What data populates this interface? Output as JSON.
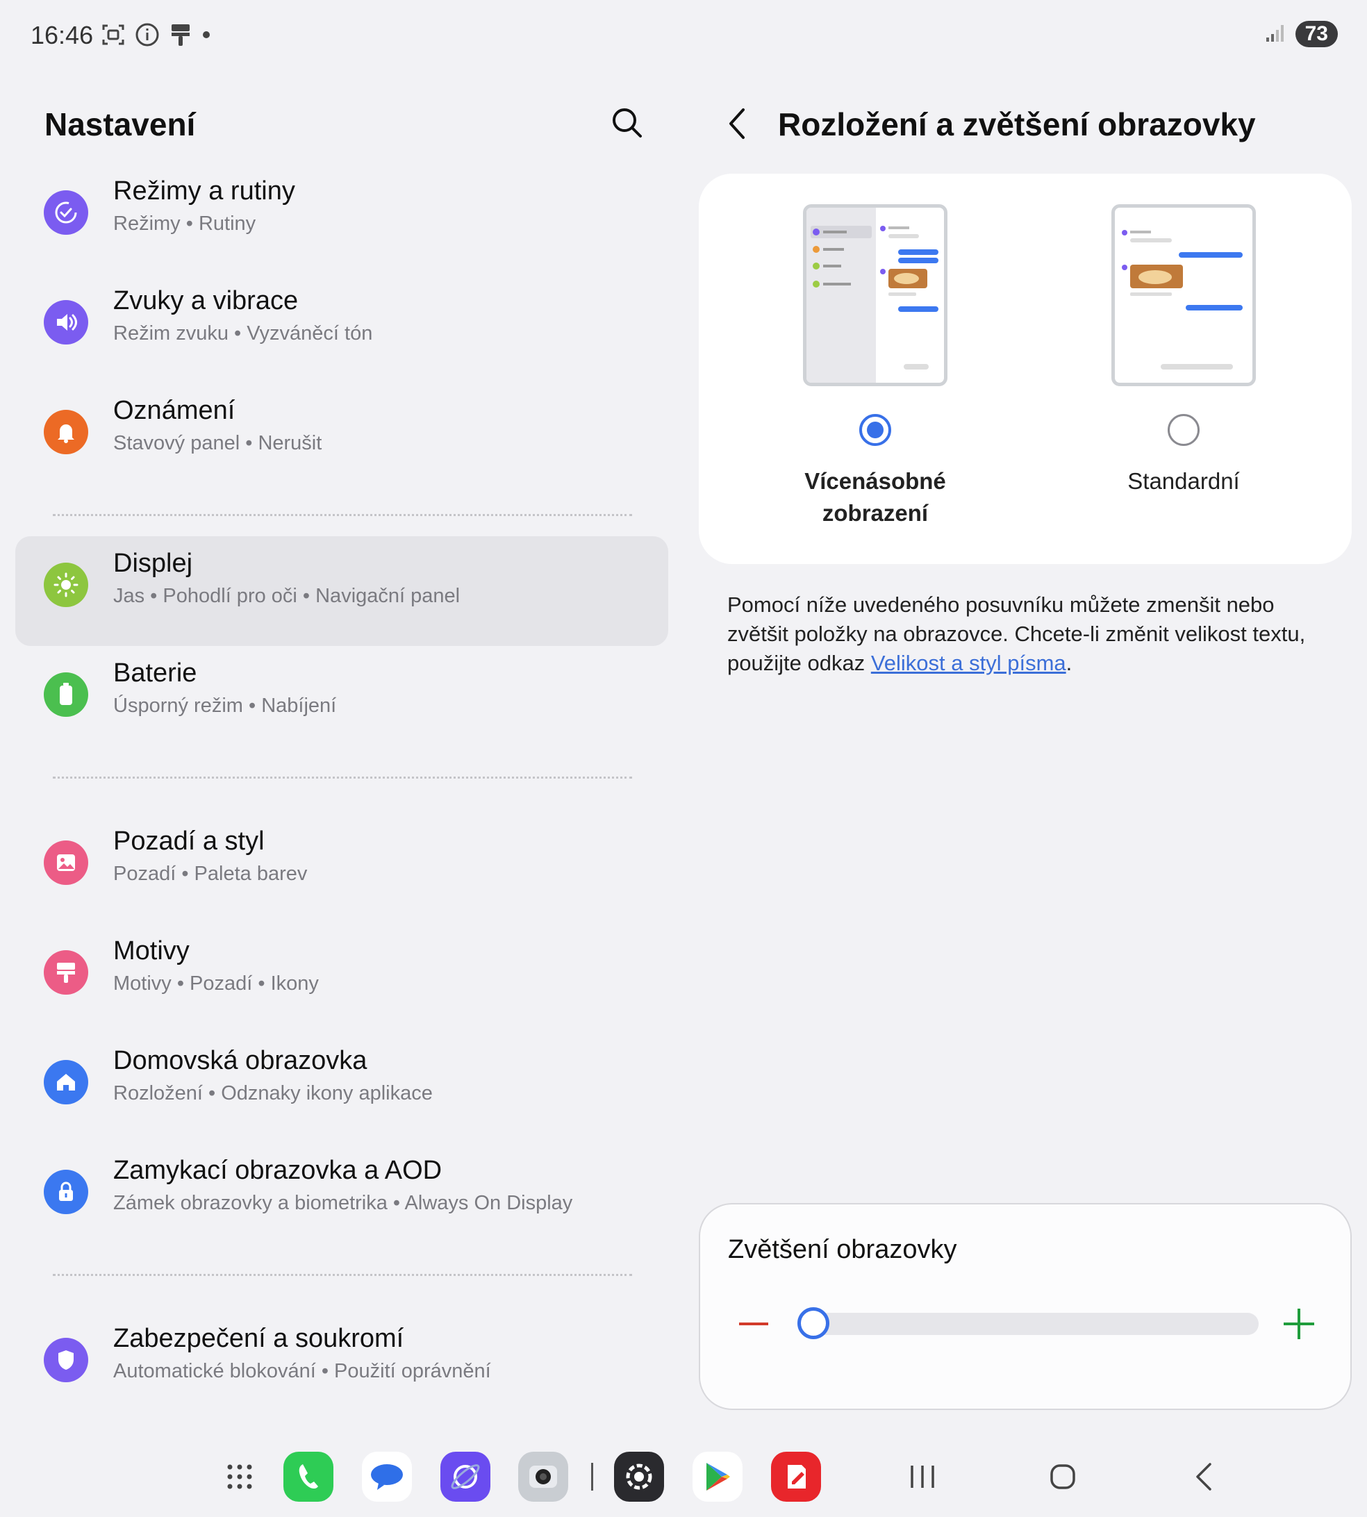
{
  "status": {
    "time": "16:46",
    "battery": "73"
  },
  "left": {
    "title": "Nastavení",
    "items": [
      {
        "title": "Režimy a rutiny",
        "subtitle": "Režimy  •  Rutiny",
        "icon": "modes-routines-icon",
        "color": "#7b5cf0"
      },
      {
        "title": "Zvuky a vibrace",
        "subtitle": "Režim zvuku  •  Vyzváněcí tón",
        "icon": "sound-icon",
        "color": "#7b5cf0"
      },
      {
        "title": "Oznámení",
        "subtitle": "Stavový panel  •  Nerušit",
        "icon": "bell-icon",
        "color": "#ec6a25"
      },
      {
        "title": "Displej",
        "subtitle": "Jas  •  Pohodlí pro oči  •  Navigační panel",
        "icon": "brightness-icon",
        "color": "#8dc63f"
      },
      {
        "title": "Baterie",
        "subtitle": "Úsporný režim  •  Nabíjení",
        "icon": "battery-icon",
        "color": "#4bbf4f"
      },
      {
        "title": "Pozadí a styl",
        "subtitle": "Pozadí  •  Paleta barev",
        "icon": "wallpaper-icon",
        "color": "#ec5c86"
      },
      {
        "title": "Motivy",
        "subtitle": "Motivy  •  Pozadí  •  Ikony",
        "icon": "themes-icon",
        "color": "#ec5c86"
      },
      {
        "title": "Domovská obrazovka",
        "subtitle": "Rozložení  •  Odznaky ikony aplikace",
        "icon": "home-icon",
        "color": "#3b78f0"
      },
      {
        "title": "Zamykací obrazovka a AOD",
        "subtitle": "Zámek obrazovky a biometrika  •  Always On Display",
        "icon": "lock-icon",
        "color": "#3b78f0"
      },
      {
        "title": "Zabezpečení a soukromí",
        "subtitle": "Automatické blokování  •  Použití oprávnění",
        "icon": "shield-icon",
        "color": "#7b5cf0"
      }
    ]
  },
  "right": {
    "title": "Rozložení a zvětšení obrazovky",
    "options": [
      {
        "label_line1": "Vícenásobné",
        "label_line2": "zobrazení",
        "selected": true
      },
      {
        "label_line1": "Standardní",
        "label_line2": "",
        "selected": false
      }
    ],
    "description_prefix": "Pomocí níže uvedeného posuvníku můžete zmenšit nebo zvětšit položky na obrazovce. Chcete-li změnit velikost textu, použijte odkaz ",
    "description_link": "Velikost a styl písma",
    "description_suffix": ".",
    "zoom_title": "Zvětšení obrazovky",
    "zoom_level": 0
  },
  "dock": {
    "apps": [
      "apps-grid-icon",
      "phone-app-icon",
      "messages-app-icon",
      "internet-app-icon",
      "camera-app-icon",
      "settings-app-icon",
      "play-store-icon",
      "notes-app-icon"
    ],
    "colors": {
      "phone": "#2ecc55",
      "messages": "#2f6fe8",
      "internet": "#6a4cf0",
      "settings": "#2a2a2e",
      "notes": "#e8262b"
    }
  }
}
